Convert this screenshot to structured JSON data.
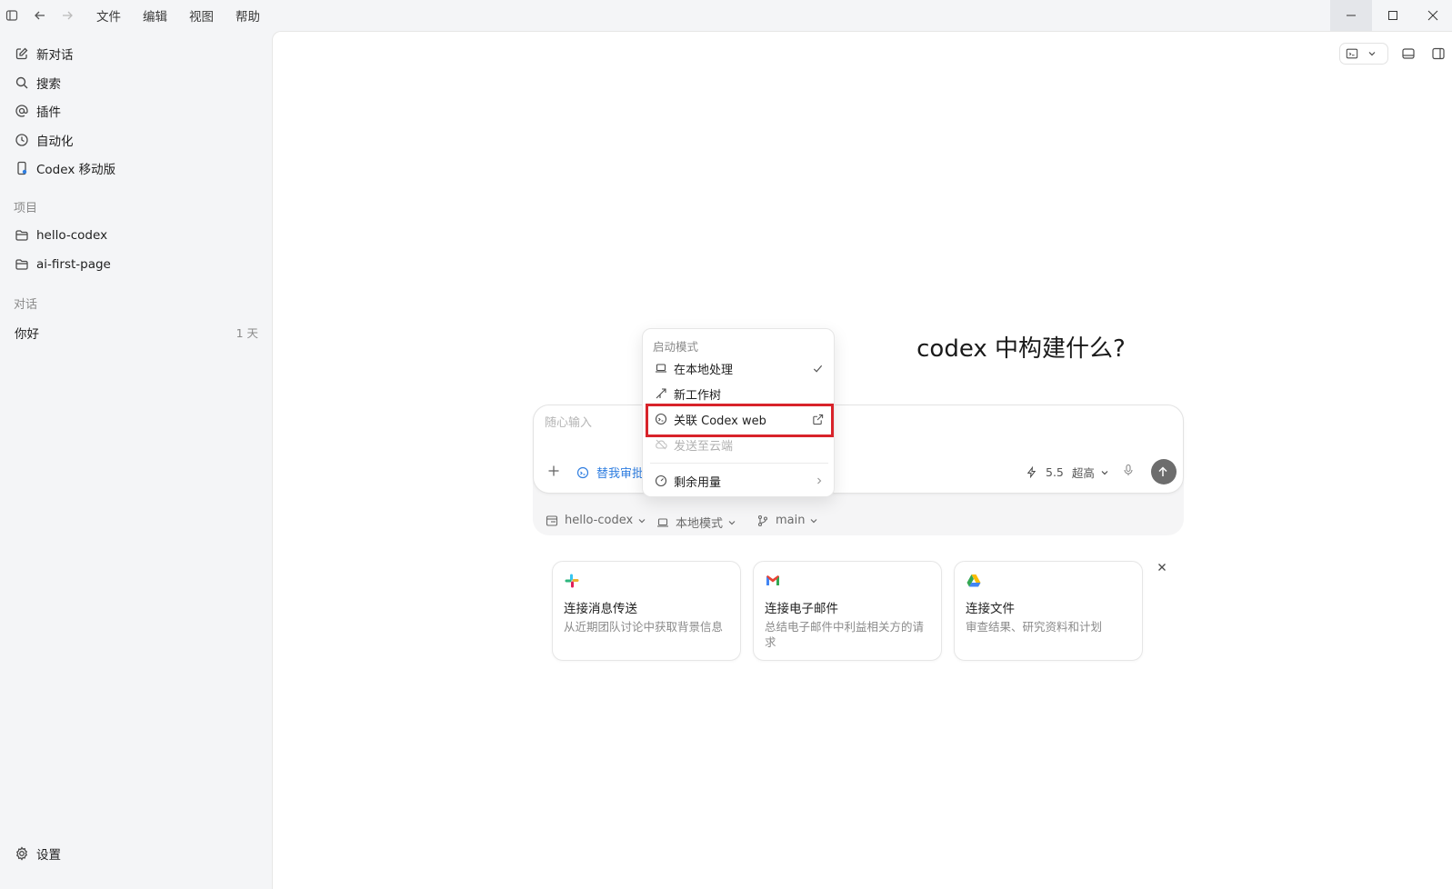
{
  "menubar": {
    "items": [
      "文件",
      "编辑",
      "视图",
      "帮助"
    ]
  },
  "sidebar": {
    "nav": [
      {
        "label": "新对话",
        "icon": "edit-icon"
      },
      {
        "label": "搜索",
        "icon": "search-icon"
      },
      {
        "label": "插件",
        "icon": "at-icon"
      },
      {
        "label": "自动化",
        "icon": "clock-icon"
      },
      {
        "label": "Codex 移动版",
        "icon": "mobile-icon"
      }
    ],
    "projects_label": "项目",
    "projects": [
      "hello-codex",
      "ai-first-page"
    ],
    "conversations_label": "对话",
    "conversations": [
      {
        "title": "你好",
        "time": "1 天"
      }
    ],
    "settings_label": "设置"
  },
  "main": {
    "heading": "codex 中构建什么?",
    "composer": {
      "placeholder": "随心输入",
      "approval_label": "替我审批",
      "model_version": "5.5",
      "reasoning": "超高"
    },
    "tray": {
      "project": "hello-codex",
      "mode": "本地模式",
      "branch": "main"
    },
    "dropdown": {
      "title": "启动模式",
      "items": [
        {
          "label": "在本地处理",
          "checked": true
        },
        {
          "label": "新工作树"
        },
        {
          "label": "关联 Codex web",
          "highlighted": true
        },
        {
          "label": "发送至云端",
          "disabled": true
        },
        {
          "label": "剩余用量"
        }
      ]
    },
    "cards": [
      {
        "title": "连接消息传送",
        "desc": "从近期团队讨论中获取背景信息"
      },
      {
        "title": "连接电子邮件",
        "desc": "总结电子邮件中利益相关方的请求"
      },
      {
        "title": "连接文件",
        "desc": "审查结果、研究资料和计划"
      }
    ]
  },
  "colors": {
    "highlight": "#d8232a",
    "accent": "#2f7ee0",
    "send_button": "#6d6d6d"
  }
}
